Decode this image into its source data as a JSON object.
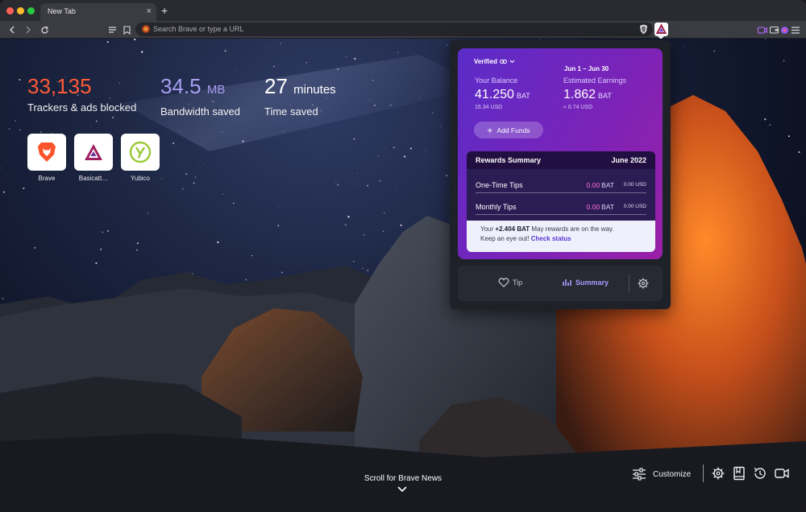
{
  "browser": {
    "tab_title": "New Tab",
    "tab_close": "×",
    "new_tab": "+",
    "url_placeholder": "Search Brave or type a URL"
  },
  "stats": [
    {
      "value": "33,135",
      "unit": "",
      "label": "Trackers & ads blocked",
      "color": "#ff5a36"
    },
    {
      "value": "34.5",
      "unit": "MB",
      "label": "Bandwidth saved",
      "color": "#a79ff0"
    },
    {
      "value": "27",
      "unit": "minutes",
      "label": "Time saved",
      "color": "#ffffff"
    }
  ],
  "top_sites": [
    {
      "label": "Brave",
      "icon": "brave-lion-icon"
    },
    {
      "label": "Basicatt…",
      "icon": "bat-triangle-icon"
    },
    {
      "label": "Yubico",
      "icon": "yubico-icon"
    }
  ],
  "rewards": {
    "verified_label": "Verified",
    "period": "Jun 1 – Jun 30",
    "balance_label": "Your Balance",
    "balance_value": "41.250",
    "balance_unit": "BAT",
    "balance_usd": "16.34 USD",
    "earnings_label": "Estimated Earnings",
    "earnings_value": "1.862",
    "earnings_unit": "BAT",
    "earnings_usd": "≈ 0.74 USD",
    "add_funds": "Add Funds",
    "summary_title": "Rewards Summary",
    "summary_month": "June 2022",
    "rows": [
      {
        "label": "One-Time Tips",
        "bat": "0.00",
        "bat_unit": "BAT",
        "usd": "0.00 USD"
      },
      {
        "label": "Monthly Tips",
        "bat": "0.00",
        "bat_unit": "BAT",
        "usd": "0.00 USD"
      }
    ],
    "notice_prefix": "Your",
    "notice_amount": "+2.404 BAT",
    "notice_text": "May rewards are on the way.",
    "notice_line2": "Keep an eye out!",
    "notice_link": "Check status",
    "footer_tip": "Tip",
    "footer_summary": "Summary"
  },
  "bottom": {
    "scroll_news": "Scroll for Brave News",
    "customize": "Customize"
  },
  "colors": {
    "accent_orange": "#ff5a36",
    "accent_purple": "#a79ff0",
    "tip_pink": "#ff6fd7",
    "link_purple": "#5a37d6"
  }
}
